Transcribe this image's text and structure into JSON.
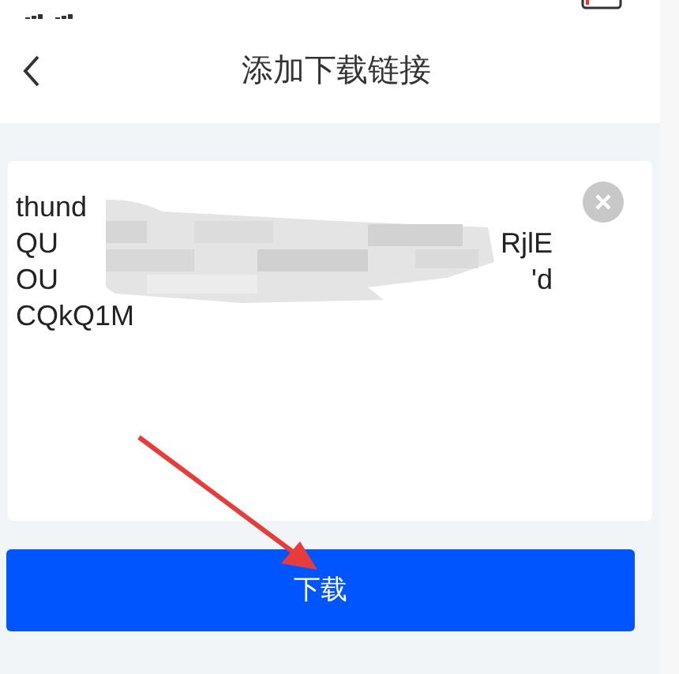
{
  "header": {
    "title": "添加下载链接"
  },
  "link_field": {
    "lines": [
      {
        "left": "thund"
      },
      {
        "left": "QU",
        "right": "RjlE"
      },
      {
        "left": "OU",
        "right": "'d"
      },
      {
        "left": "CQkQ1M"
      }
    ]
  },
  "download_button": {
    "label": "下载"
  }
}
